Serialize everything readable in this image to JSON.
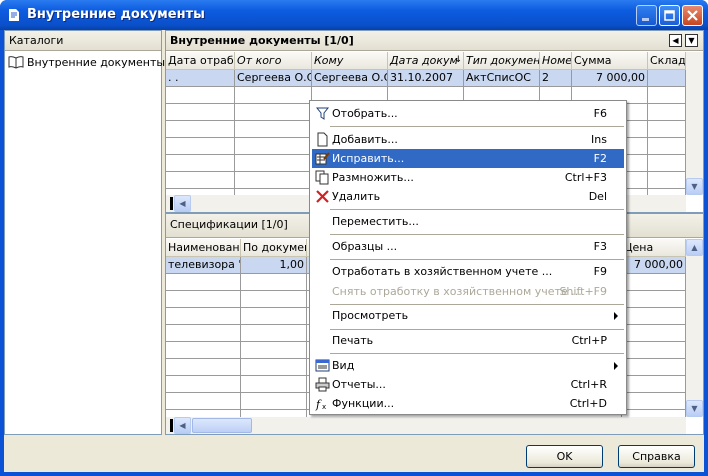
{
  "window": {
    "title": "Внутренние документы"
  },
  "catalogs": {
    "header": "Каталоги",
    "items": [
      {
        "label": "Внутренние документы",
        "icon": "book-icon"
      }
    ]
  },
  "documents": {
    "header": "Внутренние документы [1/0]",
    "columns": [
      "Дата отработ",
      "От кого",
      "Кому",
      "Дата докум",
      "Тип документ",
      "Номер",
      "Сумма",
      "Склад"
    ],
    "rows": [
      [
        ". .",
        "Сергеева О.С.",
        "Сергеева О.С",
        "31.10.2007",
        "АктСписОС",
        "2",
        "7 000,00",
        ""
      ]
    ]
  },
  "specs": {
    "header": "Спецификации [1/0]",
    "columns": [
      "Наименование",
      "По документ",
      "",
      "Цена"
    ],
    "rows": [
      [
        "телевизора \"р",
        "1,00",
        "",
        "7 000,00"
      ]
    ]
  },
  "context_menu": {
    "items": [
      {
        "label": "Отобрать...",
        "shortcut": "F6",
        "icon": "filter-icon"
      },
      {
        "separator": true
      },
      {
        "label": "Добавить...",
        "shortcut": "Ins",
        "icon": "new-doc-icon"
      },
      {
        "label": "Исправить...",
        "shortcut": "F2",
        "icon": "edit-icon",
        "highlighted": true
      },
      {
        "label": "Размножить...",
        "shortcut": "Ctrl+F3",
        "icon": "copy-icon"
      },
      {
        "label": "Удалить",
        "shortcut": "Del",
        "icon": "delete-icon"
      },
      {
        "separator": true
      },
      {
        "label": "Переместить..."
      },
      {
        "separator": true
      },
      {
        "label": "Образцы ...",
        "shortcut": "F3"
      },
      {
        "separator": true
      },
      {
        "label": "Отработать в хозяйственном учете ...",
        "shortcut": "F9"
      },
      {
        "label": "Снять отработку в хозяйственном учете ...",
        "shortcut": "Shift+F9",
        "disabled": true
      },
      {
        "separator": true
      },
      {
        "label": "Просмотреть",
        "submenu": true
      },
      {
        "separator": true
      },
      {
        "label": "Печать",
        "shortcut": "Ctrl+P"
      },
      {
        "separator": true
      },
      {
        "label": "Вид",
        "submenu": true,
        "icon": "view-icon"
      },
      {
        "label": "Отчеты...",
        "shortcut": "Ctrl+R",
        "icon": "printer-icon"
      },
      {
        "label": "Функции...",
        "shortcut": "Ctrl+D",
        "icon": "function-icon"
      }
    ]
  },
  "buttons": {
    "ok": "OK",
    "help": "Справка"
  }
}
